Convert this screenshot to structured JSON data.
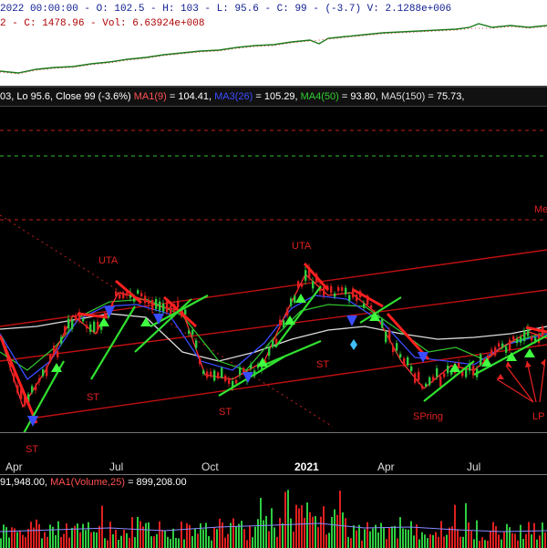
{
  "top_panel": {
    "info_line1": "2022 00:00:00 - O: 102.5 - H: 103 - L: 95.6 - C: 99 - (-3.7) V: 2.1288e+006",
    "info_line2": "2 - C: 1478.96 - Vol: 6.63924e+008"
  },
  "main_panel": {
    "legend_prefix": "03, Lo 95.6, Close 99 (-3.6%)",
    "ma1": "MA1(9)",
    "ma1_value": "= 104.41,",
    "ma3": "MA3(26)",
    "ma3_value": "= 105.29,",
    "ma4": "MA4(50)",
    "ma4_value": "= 93.80,",
    "ma5": "MA5(150)",
    "ma5_value": "= 75.73,",
    "annotations": {
      "uta_left": "UTA",
      "uta_right": "UTA",
      "st_1": "ST",
      "st_2": "ST",
      "st_3": "ST",
      "st_4": "ST",
      "spring": "SPring",
      "lps": "LP",
      "me": "Me"
    }
  },
  "time_axis": {
    "labels": [
      "Apr",
      "Jul",
      "Oct",
      "2021",
      "Apr",
      "Jul"
    ]
  },
  "volume_panel": {
    "legend_prefix": "91,948.00,",
    "ma_label": "MA1(Volume,25)",
    "ma_value": "= 899,208.00"
  },
  "colors": {
    "up_candle": "#2ecc40",
    "down_candle": "#e02020",
    "ma1": "#ff3030",
    "ma3": "#3a4cff",
    "ma4": "#30d030",
    "ma5": "#dddddd",
    "trend_red": "#d01010",
    "trend_green": "#30e030"
  }
}
